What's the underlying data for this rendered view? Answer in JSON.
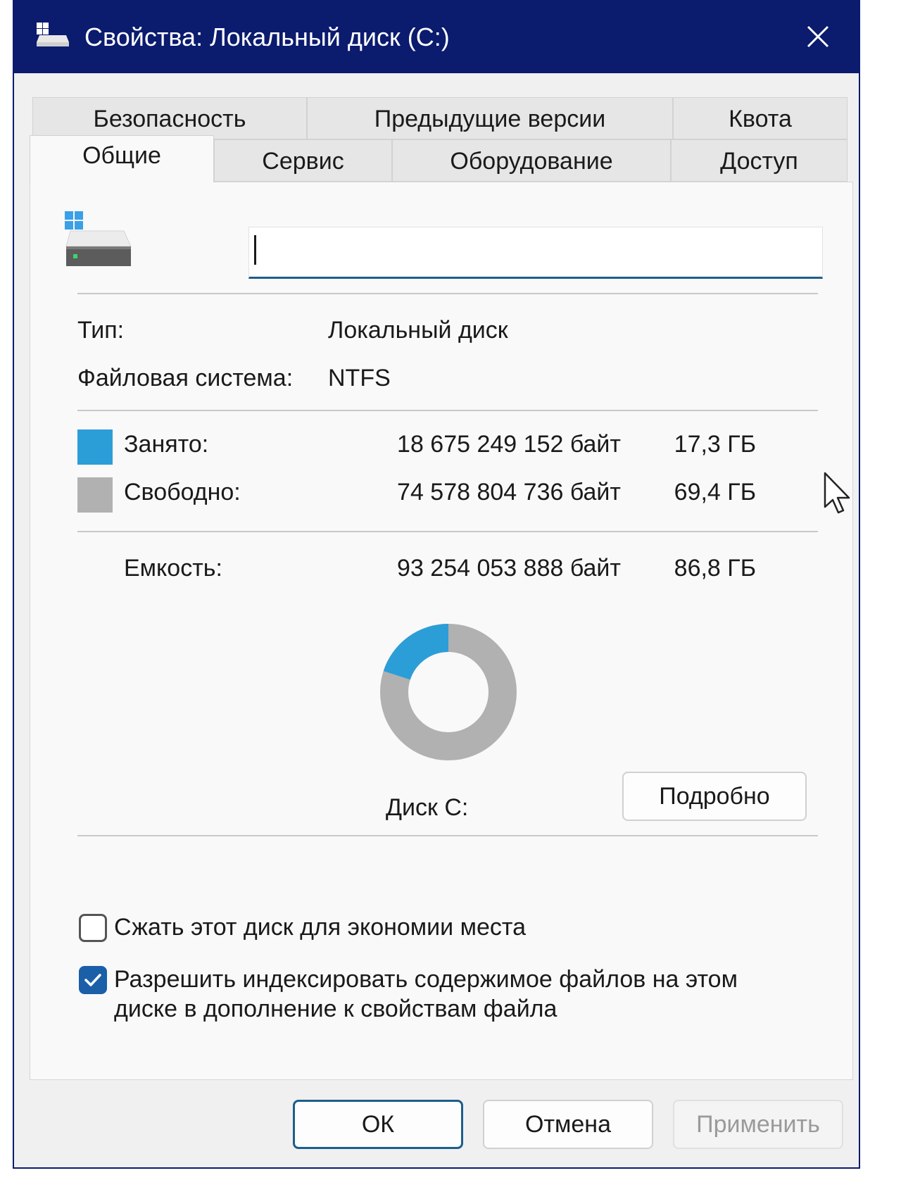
{
  "window": {
    "title": "Свойства: Локальный диск (C:)"
  },
  "tabs": {
    "row1": [
      {
        "label": "Безопасность"
      },
      {
        "label": "Предыдущие версии"
      },
      {
        "label": "Квота"
      }
    ],
    "row2": [
      {
        "label": "Общие",
        "active": true
      },
      {
        "label": "Сервис"
      },
      {
        "label": "Оборудование"
      },
      {
        "label": "Доступ"
      }
    ]
  },
  "general": {
    "drive_name_value": "",
    "type_label": "Тип:",
    "type_value": "Локальный диск",
    "fs_label": "Файловая система:",
    "fs_value": "NTFS",
    "used": {
      "label": "Занято:",
      "bytes": "18 675 249 152 байт",
      "size": "17,3 ГБ",
      "color": "#2b9ed8"
    },
    "free": {
      "label": "Свободно:",
      "bytes": "74 578 804 736 байт",
      "size": "69,4 ГБ",
      "color": "#b1b1b1"
    },
    "capacity": {
      "label": "Емкость:",
      "bytes": "93 254 053 888 байт",
      "size": "86,8 ГБ"
    },
    "disk_label": "Диск C:",
    "details_button": "Подробно",
    "usage_fraction": 0.2
  },
  "options": {
    "compress_label": "Сжать этот диск для экономии места",
    "compress_checked": false,
    "index_label_line1": "Разрешить индексировать содержимое файлов на этом",
    "index_label_line2": "диске в дополнение к свойствам файла",
    "index_checked": true
  },
  "buttons": {
    "ok": "ОК",
    "cancel": "Отмена",
    "apply": "Применить"
  },
  "icons": {
    "title": "drive-icon",
    "close": "close-icon",
    "drive": "windows-drive-icon",
    "checkmark": "checkmark-icon",
    "cursor": "mouse-pointer-icon"
  },
  "colors": {
    "titlebar": "#0b1b6e",
    "accent": "#1d5e8c",
    "used": "#2b9ed8",
    "free": "#b1b1b1"
  }
}
